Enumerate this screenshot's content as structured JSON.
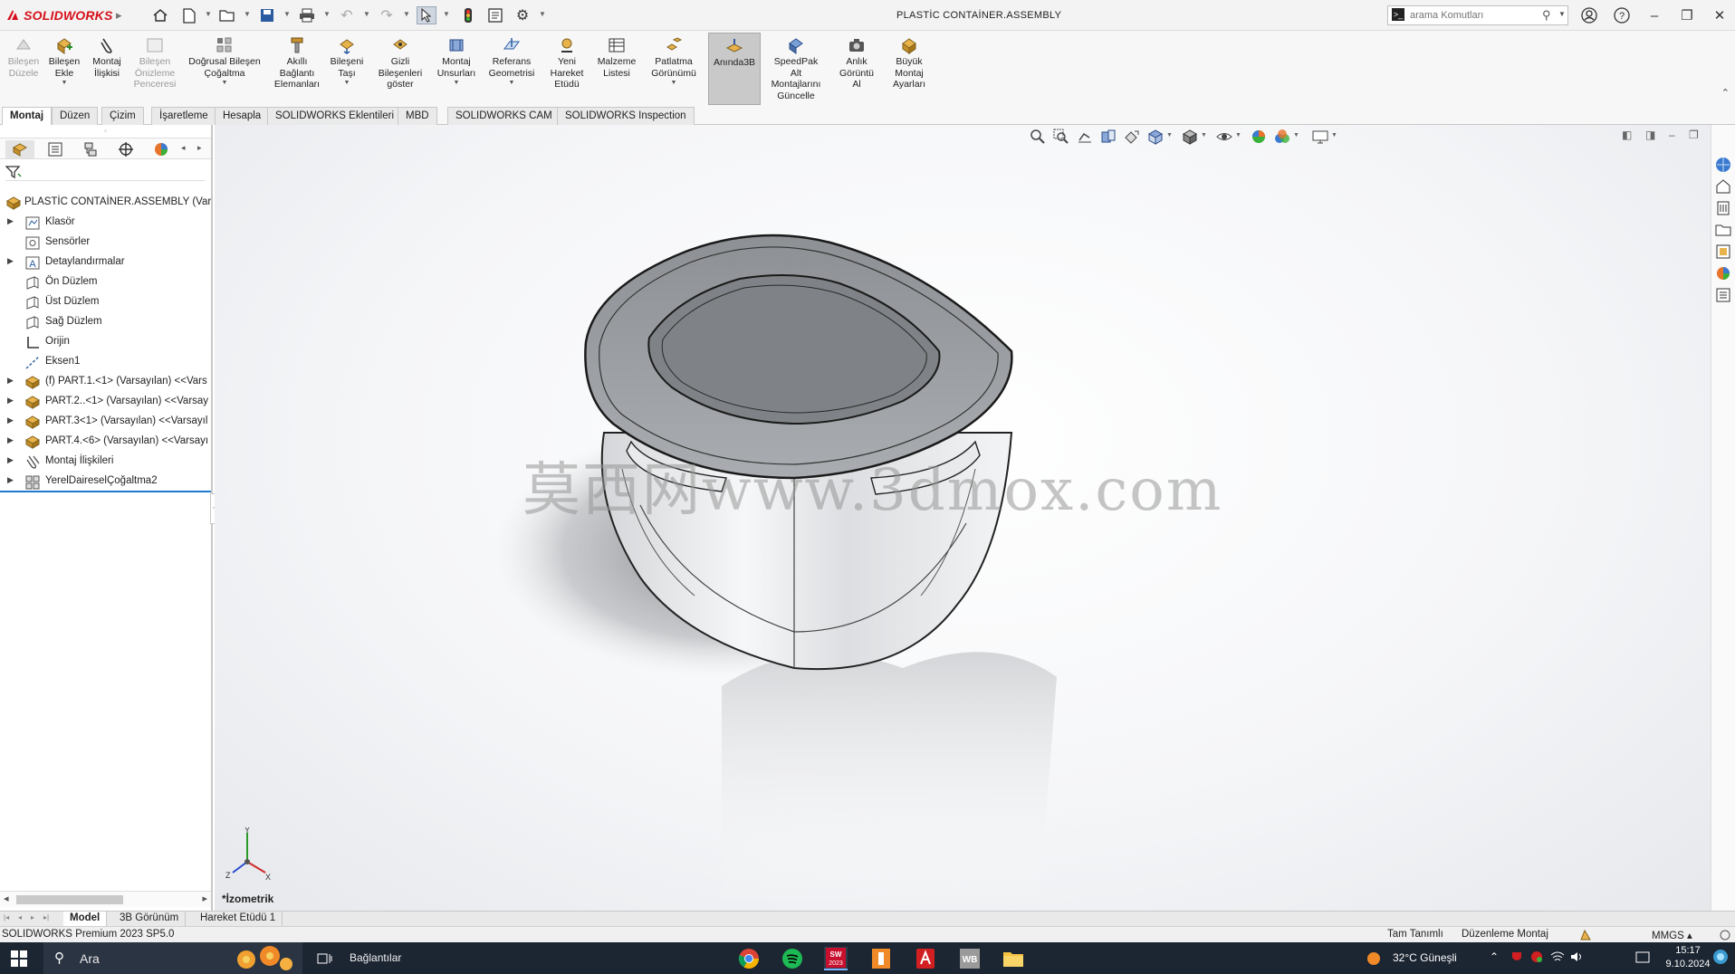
{
  "app": {
    "logo_text": "SOLIDWORKS",
    "document_title": "PLASTİC CONTAİNER.ASSEMBLY"
  },
  "quick_access": {
    "icons": [
      "home-icon",
      "new-document-icon",
      "open-folder-icon",
      "save-icon",
      "print-icon",
      "undo-icon",
      "redo-icon",
      "select-cursor-icon",
      "traffic-light-icon",
      "file-properties-icon",
      "options-gear-icon"
    ]
  },
  "search": {
    "placeholder": "arama Komutları"
  },
  "window_controls": {
    "icons": [
      "user-account-icon",
      "help-icon",
      "minimize-icon",
      "restore-icon",
      "close-icon"
    ]
  },
  "commands": [
    {
      "label": "Bileşen\nDüzele",
      "enabled": false
    },
    {
      "label": "Bileşen\nEkle",
      "enabled": true
    },
    {
      "label": "Montaj\nİlişkisi",
      "enabled": true
    },
    {
      "label": "Bileşen\nÖnizleme\nPenceresi",
      "enabled": false
    },
    {
      "label": "Doğrusal Bileşen\nÇoğaltma",
      "enabled": true
    },
    {
      "label": "Akıllı\nBağlantı\nElemanları",
      "enabled": true
    },
    {
      "label": "Bileşeni\nTaşı",
      "enabled": true
    },
    {
      "label": "Gizli\nBileşenleri\ngöster",
      "enabled": true
    },
    {
      "label": "Montaj\nUnsurları",
      "enabled": true
    },
    {
      "label": "Referans\nGeometrisi",
      "enabled": true
    },
    {
      "label": "Yeni\nHareket\nEtüdü",
      "enabled": true
    },
    {
      "label": "Malzeme\nListesi",
      "enabled": true
    },
    {
      "label": "Patlatma\nGörünümü",
      "enabled": true
    },
    {
      "label": "Anında3B",
      "enabled": true
    },
    {
      "label": "SpeedPak\nAlt\nMontajlarını\nGüncelle",
      "enabled": true
    },
    {
      "label": "Anlık\nGörüntü\nAl",
      "enabled": true
    },
    {
      "label": "Büyük\nMontaj\nAyarları",
      "enabled": true
    }
  ],
  "tabs": [
    "Montaj",
    "Düzen",
    "Çizim",
    "İşaretleme",
    "Hesapla",
    "SOLIDWORKS Eklentileri",
    "MBD",
    "SOLIDWORKS CAM",
    "SOLIDWORKS Inspection"
  ],
  "active_tab": "Montaj",
  "tree": {
    "root": "PLASTİC CONTAİNER.ASSEMBLY (Varsa",
    "items": [
      {
        "label": "Klasör",
        "expandable": true
      },
      {
        "label": "Sensörler",
        "expandable": false
      },
      {
        "label": "Detaylandırmalar",
        "expandable": true
      },
      {
        "label": "Ön Düzlem",
        "expandable": false
      },
      {
        "label": "Üst Düzlem",
        "expandable": false
      },
      {
        "label": "Sağ Düzlem",
        "expandable": false
      },
      {
        "label": "Orijin",
        "expandable": false
      },
      {
        "label": "Eksen1",
        "expandable": false
      },
      {
        "label": "(f) PART.1.<1> (Varsayılan) <<Vars",
        "expandable": true
      },
      {
        "label": "PART.2..<1> (Varsayılan) <<Varsay",
        "expandable": true
      },
      {
        "label": "PART.3<1> (Varsayılan) <<Varsayıl",
        "expandable": true
      },
      {
        "label": "PART.4.<6> (Varsayılan) <<Varsayı",
        "expandable": true
      },
      {
        "label": "Montaj İlişkileri",
        "expandable": true
      },
      {
        "label": "YerelDaireselÇoğaltma2",
        "expandable": true
      }
    ]
  },
  "graphics": {
    "view_label": "*İzometrik",
    "watermark": "莫西网www.3dmox.com",
    "triad_axes": [
      "Y",
      "Z",
      "X"
    ]
  },
  "model_tabs": [
    "Model",
    "3B Görünüm",
    "Hareket Etüdü 1"
  ],
  "active_model_tab": "Model",
  "status": {
    "product": "SOLIDWORKS Premium 2023 SP5.0",
    "definition": "Tam Tanımlı",
    "mode": "Düzenleme Montaj",
    "units": "MMGS"
  },
  "taskbar": {
    "search_text": "Ara",
    "task_label": "Bağlantılar",
    "weather": "32°C  Güneşli",
    "time": "15:17",
    "date": "9.10.2024",
    "apps": [
      "chrome-icon",
      "spotify-icon",
      "solidworks-2023-icon",
      "keyshot-icon",
      "acrobat-icon",
      "workbench-icon",
      "file-explorer-icon"
    ],
    "sw_badge": "2023"
  },
  "colors": {
    "brand_red": "#d6101a",
    "selection_blue": "#1e7ad0",
    "taskbar_bg": "#1c2532"
  }
}
